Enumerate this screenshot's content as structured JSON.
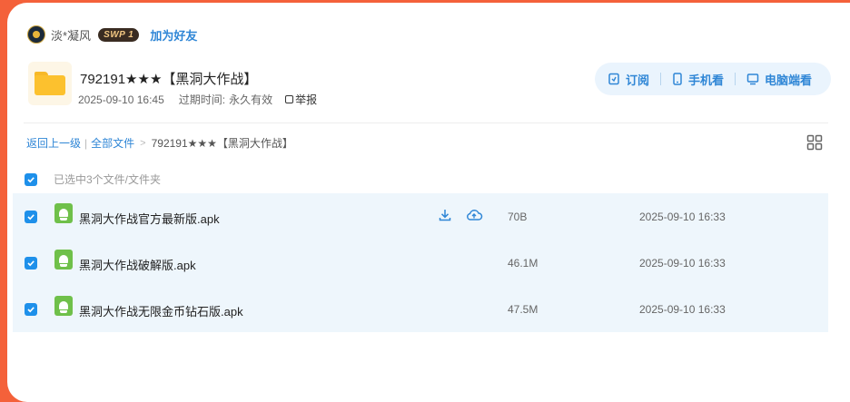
{
  "user": {
    "name": "淡*凝风",
    "badge": "SWP 1",
    "add_friend": "加为好友"
  },
  "folder": {
    "title": "792191★★★【黑洞大作战】",
    "date": "2025-09-10 16:45",
    "expire_label": "过期时间:",
    "expire_value": "永久有效",
    "report": "举报"
  },
  "actions": {
    "subscribe": "订阅",
    "mobile": "手机看",
    "pc": "电脑端看"
  },
  "breadcrumb": {
    "back": "返回上一级",
    "all_files": "全部文件",
    "current": "792191★★★【黑洞大作战】"
  },
  "selection": {
    "label": "已选中3个文件/文件夹"
  },
  "files": [
    {
      "name": "黑洞大作战官方最新版.apk",
      "size": "70B",
      "date": "2025-09-10 16:33"
    },
    {
      "name": "黑洞大作战破解版.apk",
      "size": "46.1M",
      "date": "2025-09-10 16:33"
    },
    {
      "name": "黑洞大作战无限金币钻石版.apk",
      "size": "47.5M",
      "date": "2025-09-10 16:33"
    }
  ],
  "colors": {
    "accent": "#2f86d6",
    "checkbox": "#1e90ea",
    "row_bg": "#eef6fc",
    "frame": "#f4613a"
  }
}
